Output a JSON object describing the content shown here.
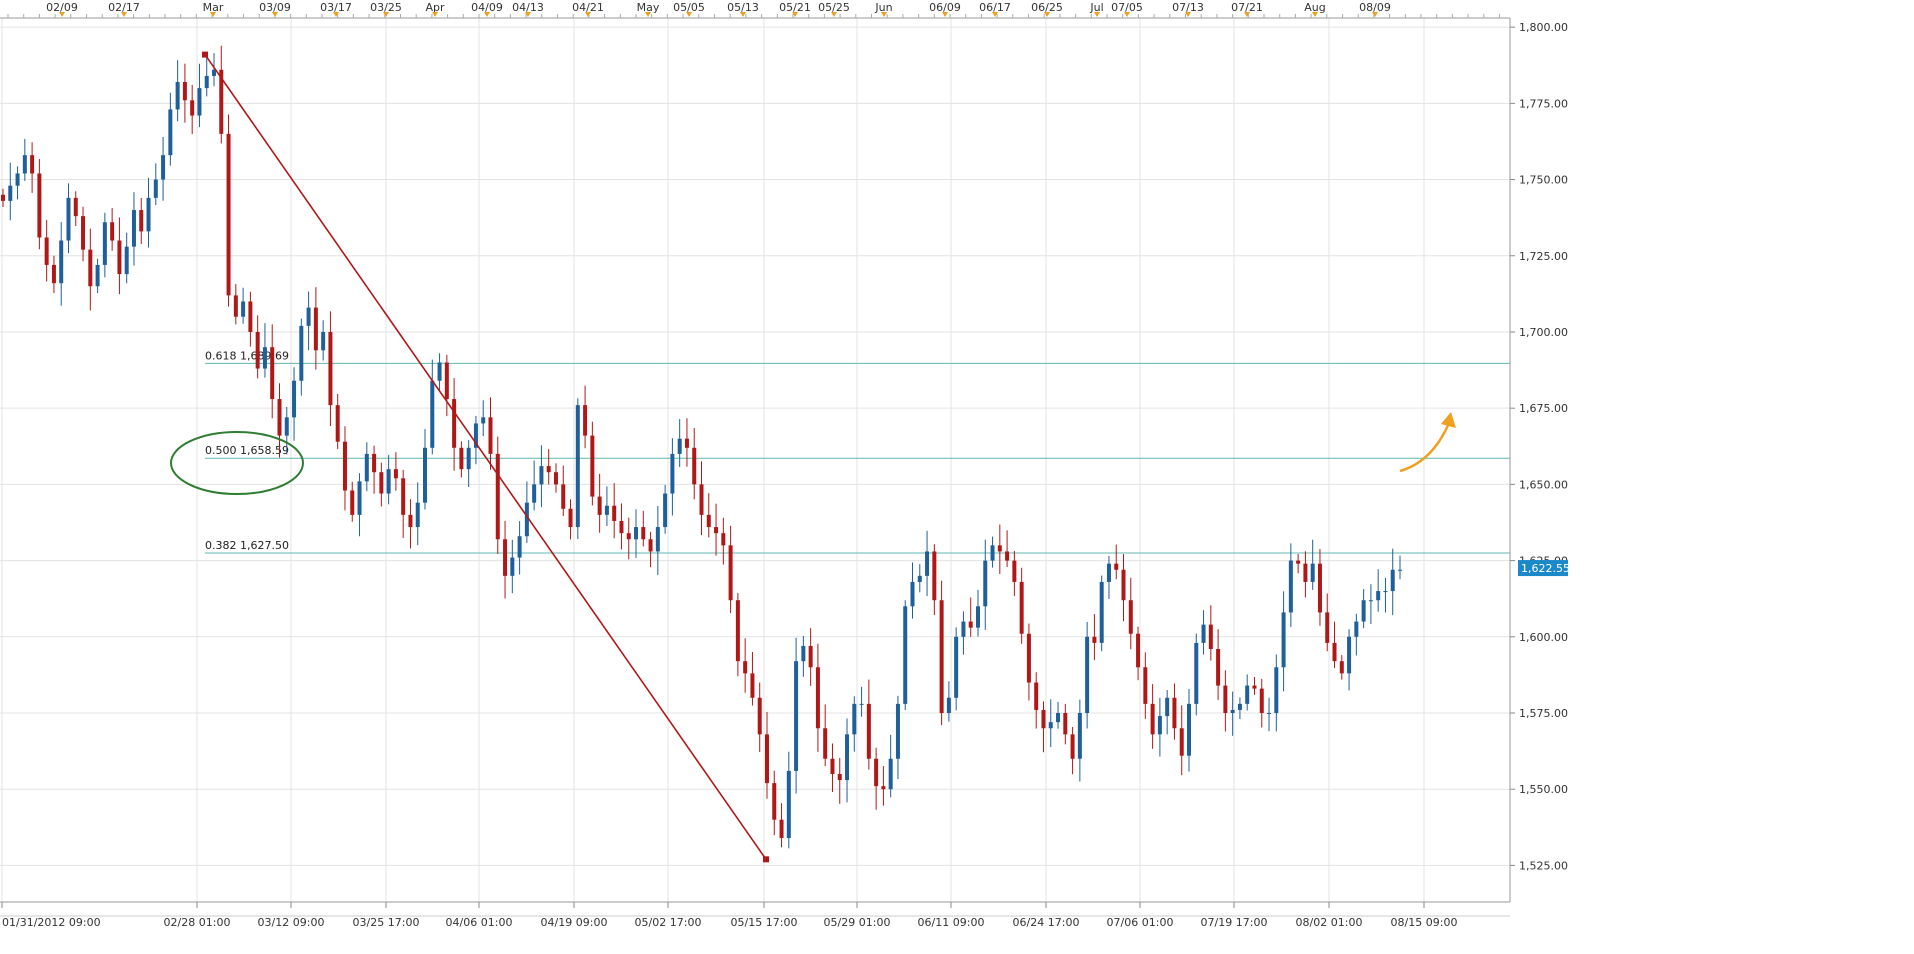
{
  "chart_data": {
    "type": "candlestick",
    "instrument_price_last": "1,622.55",
    "colors": {
      "up": "#1f5f9a",
      "down": "#b01818",
      "trendline": "#b01818",
      "fib_line": "#5fb8b0",
      "ellipse": "#2e7d32",
      "arrow": "#f0a020",
      "last_price_bg": "#1a88c9",
      "marker": "#f0a020",
      "grid": "#e3e3e3"
    },
    "ylim": [
      1513,
      1803
    ],
    "y_ticks": [
      "1,525.00",
      "1,550.00",
      "1,575.00",
      "1,600.00",
      "1,625.00",
      "1,650.00",
      "1,675.00",
      "1,700.00",
      "1,725.00",
      "1,750.00",
      "1,775.00",
      "1,800.00"
    ],
    "x_ticks_bottom": [
      "01/31/2012 09:00",
      "02/28 01:00",
      "03/12 09:00",
      "03/25 17:00",
      "04/06 01:00",
      "04/19 09:00",
      "05/02 17:00",
      "05/15 17:00",
      "05/29 01:00",
      "06/11 09:00",
      "06/24 17:00",
      "07/06 01:00",
      "07/19 17:00",
      "08/02 01:00",
      "08/15 09:00"
    ],
    "x_ticks_top": [
      "02/09",
      "02/17",
      "Mar",
      "03/09",
      "03/17",
      "03/25",
      "Apr",
      "04/09",
      "04/13",
      "04/21",
      "May",
      "05/05",
      "05/13",
      "05/21",
      "05/25",
      "Jun",
      "06/09",
      "06/17",
      "06/25",
      "Jul",
      "07/05",
      "07/13",
      "07/21",
      "Aug",
      "08/09"
    ],
    "fibonacci": [
      {
        "label": "0.618 1,689.69",
        "value": 1689.69
      },
      {
        "label": "0.500 1,658.59",
        "value": 1658.59
      },
      {
        "label": "0.382 1,627.50",
        "value": 1627.5
      }
    ],
    "trendline": {
      "from": {
        "x": "02/28 01:00",
        "y": 1791
      },
      "to": {
        "x": "05/15 17:00",
        "y": 1527
      }
    },
    "closes": [
      1743,
      1748,
      1752,
      1758,
      1752,
      1731,
      1722,
      1716,
      1730,
      1744,
      1738,
      1727,
      1715,
      1722,
      1736,
      1730,
      1719,
      1728,
      1740,
      1733,
      1744,
      1750,
      1758,
      1773,
      1782,
      1776,
      1771,
      1780,
      1784,
      1786,
      1765,
      1712,
      1705,
      1710,
      1700,
      1688,
      1695,
      1678,
      1666,
      1672,
      1684,
      1702,
      1708,
      1694,
      1700,
      1676,
      1664,
      1648,
      1640,
      1651,
      1660,
      1654,
      1647,
      1655,
      1652,
      1640,
      1636,
      1644,
      1662,
      1684,
      1690,
      1678,
      1662,
      1655,
      1662,
      1670,
      1672,
      1660,
      1632,
      1620,
      1626,
      1633,
      1644,
      1650,
      1656,
      1654,
      1650,
      1642,
      1636,
      1676,
      1666,
      1646,
      1640,
      1643,
      1638,
      1634,
      1632,
      1636,
      1632,
      1628,
      1636,
      1647,
      1660,
      1665,
      1662,
      1650,
      1640,
      1636,
      1634,
      1630,
      1612,
      1592,
      1588,
      1580,
      1568,
      1552,
      1540,
      1534,
      1556,
      1592,
      1597,
      1590,
      1570,
      1560,
      1555,
      1553,
      1568,
      1578,
      1578,
      1560,
      1551,
      1550,
      1560,
      1578,
      1610,
      1618,
      1620,
      1628,
      1612,
      1575,
      1580,
      1600,
      1605,
      1603,
      1610,
      1625,
      1630,
      1628,
      1625,
      1618,
      1601,
      1585,
      1576,
      1570,
      1572,
      1575,
      1568,
      1560,
      1575,
      1600,
      1598,
      1618,
      1624,
      1622,
      1612,
      1601,
      1590,
      1578,
      1568,
      1574,
      1580,
      1570,
      1561,
      1578,
      1598,
      1604,
      1596,
      1584,
      1575,
      1576,
      1578,
      1584,
      1583,
      1575,
      1575,
      1590,
      1608,
      1625,
      1624,
      1618,
      1624,
      1608,
      1598,
      1592,
      1588,
      1600,
      1605,
      1612,
      1612,
      1615,
      1615,
      1622,
      1622
    ]
  }
}
